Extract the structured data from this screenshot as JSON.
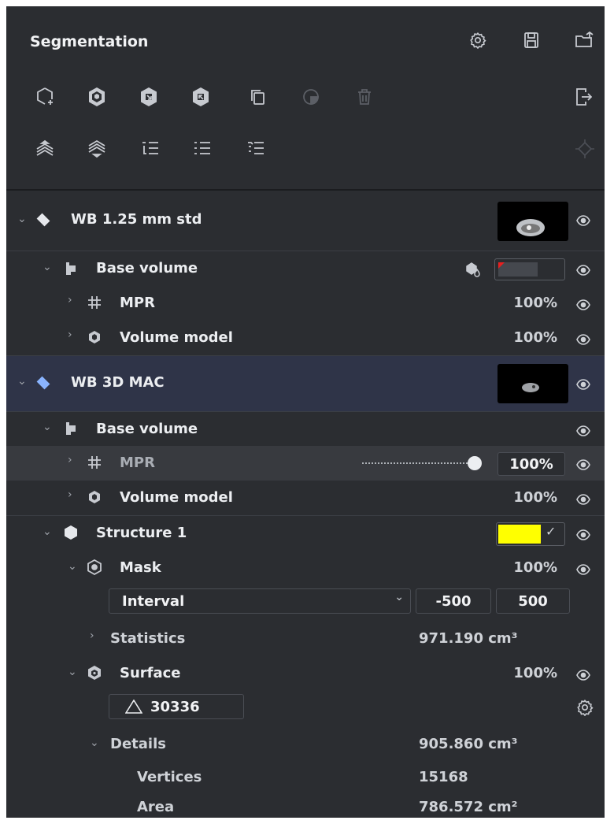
{
  "panel": {
    "title": "Segmentation"
  },
  "toolbar": {
    "row1": [
      "add-segment-icon",
      "cube-outline-icon",
      "cube-import-icon",
      "cube-export-icon",
      "copy-icon",
      "pie-icon",
      "trash-icon"
    ],
    "row2": [
      "layers-up-icon",
      "layers-down-icon",
      "list-indent-icon",
      "list-icon",
      "list-collapse-icon"
    ]
  },
  "tree": {
    "series1": {
      "label": "WB 1.25 mm std"
    },
    "s1_base": {
      "label": "Base volume"
    },
    "s1_mpr": {
      "label": "MPR",
      "opacity": "100%"
    },
    "s1_vol": {
      "label": "Volume model",
      "opacity": "100%"
    },
    "series2": {
      "label": "WB 3D MAC"
    },
    "s2_base": {
      "label": "Base volume"
    },
    "s2_mpr": {
      "label": "MPR",
      "opacity": "100%"
    },
    "s2_vol": {
      "label": "Volume model",
      "opacity": "100%"
    },
    "structure": {
      "label": "Structure 1",
      "color": "#ffff00"
    },
    "mask": {
      "label": "Mask",
      "opacity": "100%"
    },
    "interval": {
      "mode": "Interval",
      "min": "-500",
      "max": "500"
    },
    "statistics": {
      "label": "Statistics",
      "value": "971.190 cm³"
    },
    "surface": {
      "label": "Surface",
      "opacity": "100%"
    },
    "triangles": {
      "value": "30336"
    },
    "details": {
      "label": "Details",
      "value": "905.860 cm³"
    },
    "vertices": {
      "label": "Vertices",
      "value": "15168"
    },
    "area": {
      "label": "Area",
      "value": "786.572 cm²"
    }
  },
  "colors": {
    "panel_bg": "#2b2d31",
    "selected_bg": "#2f3448",
    "accent_diamond": "#8ab4ff",
    "structure_color": "#ffff00"
  }
}
